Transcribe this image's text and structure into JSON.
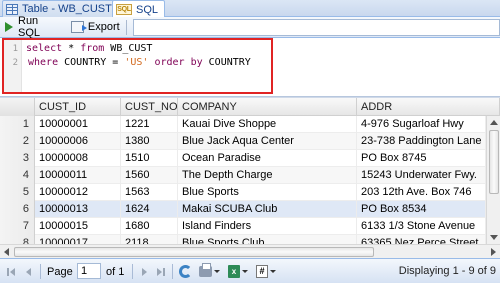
{
  "tabs": [
    {
      "label": "Table - WB_CUST",
      "icon": "table-icon",
      "active": false
    },
    {
      "label": "SQL",
      "icon": "sql-icon",
      "active": true
    }
  ],
  "toolbar": {
    "run_label": "Run SQL",
    "export_label": "Export"
  },
  "editor": {
    "lines": [
      {
        "number": "1",
        "keyword1": "select",
        "text1": " * ",
        "keyword2": "from",
        "text2": " WB_CUST"
      },
      {
        "number": "2",
        "keyword1": "where",
        "text1": " COUNTRY = ",
        "string": "'US'",
        "keyword2": "order by",
        "text2": " COUNTRY"
      }
    ]
  },
  "grid": {
    "columns": [
      "CUST_ID",
      "CUST_NO",
      "COMPANY",
      "ADDR"
    ],
    "rows": [
      {
        "n": "1",
        "cust_id": "10000001",
        "cust_no": "1221",
        "company": "Kauai Dive Shoppe",
        "addr": "4-976 Sugarloaf Hwy"
      },
      {
        "n": "2",
        "cust_id": "10000006",
        "cust_no": "1380",
        "company": "Blue Jack Aqua Center",
        "addr": "23-738 Paddington Lane"
      },
      {
        "n": "3",
        "cust_id": "10000008",
        "cust_no": "1510",
        "company": "Ocean Paradise",
        "addr": "PO Box 8745"
      },
      {
        "n": "4",
        "cust_id": "10000011",
        "cust_no": "1560",
        "company": "The Depth Charge",
        "addr": "15243 Underwater Fwy."
      },
      {
        "n": "5",
        "cust_id": "10000012",
        "cust_no": "1563",
        "company": "Blue Sports",
        "addr": "203 12th Ave. Box 746"
      },
      {
        "n": "6",
        "cust_id": "10000013",
        "cust_no": "1624",
        "company": "Makai SCUBA Club",
        "addr": "PO Box 8534"
      },
      {
        "n": "7",
        "cust_id": "10000015",
        "cust_no": "1680",
        "company": "Island Finders",
        "addr": "6133 1/3 Stone Avenue"
      },
      {
        "n": "8",
        "cust_id": "10000017",
        "cust_no": "2118",
        "company": "Blue Sports Club",
        "addr": "63365 Nez Perce Street"
      }
    ]
  },
  "paging": {
    "page_label": "Page",
    "page_value": "1",
    "of_label": "of 1",
    "display_text": "Displaying 1 - 9 of 9"
  },
  "colors": {
    "highlight_border": "#e02424",
    "keyword": "#7f0055",
    "string": "#d2691e",
    "tab_text": "#15428b"
  }
}
